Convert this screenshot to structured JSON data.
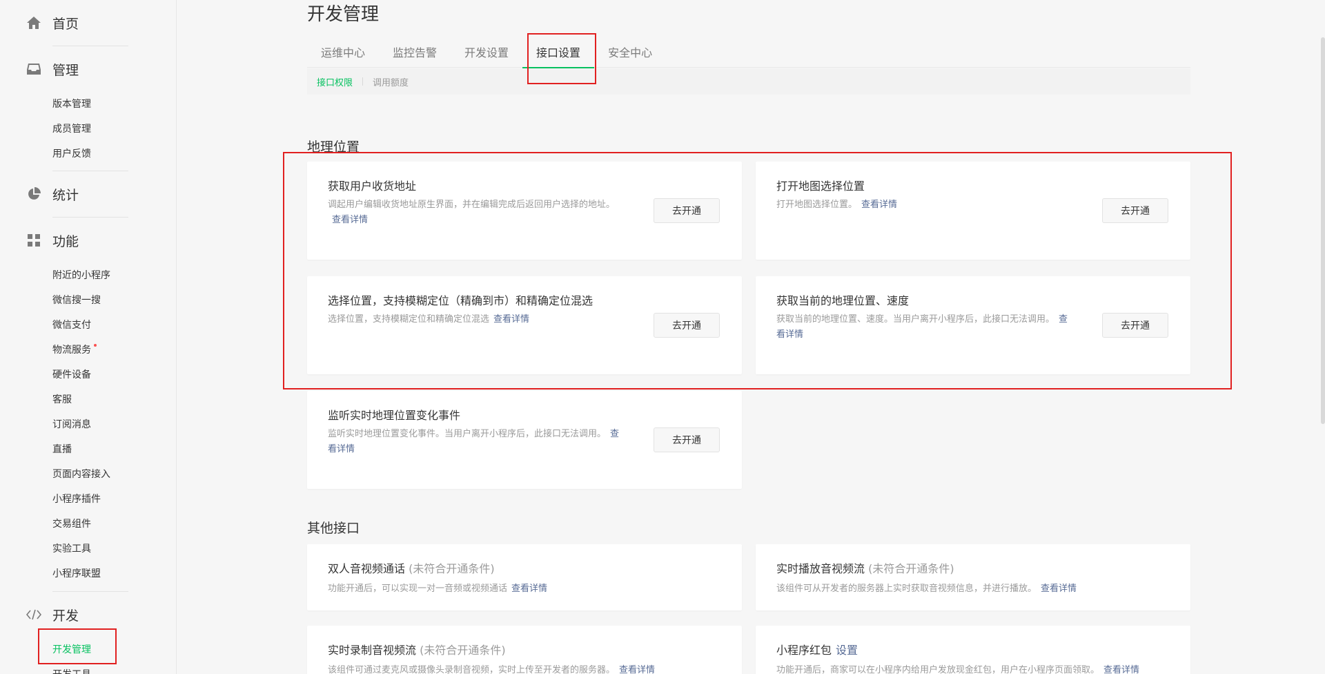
{
  "sidebar": {
    "home": {
      "label": "首页",
      "icon": "home-icon"
    },
    "manage": {
      "label": "管理",
      "icon": "inbox-icon",
      "items": [
        "版本管理",
        "成员管理",
        "用户反馈"
      ]
    },
    "stats": {
      "label": "统计",
      "icon": "pie-chart-icon"
    },
    "features": {
      "label": "功能",
      "icon": "grid-icon",
      "items": [
        "附近的小程序",
        "微信搜一搜",
        "微信支付",
        "物流服务",
        "硬件设备",
        "客服",
        "订阅消息",
        "直播",
        "页面内容接入",
        "小程序插件",
        "交易组件",
        "实验工具",
        "小程序联盟"
      ]
    },
    "dev": {
      "label": "开发",
      "icon": "code-icon",
      "items": [
        "开发管理",
        "开发工具"
      ]
    }
  },
  "main": {
    "title": "开发管理",
    "tabs": [
      "运维中心",
      "监控告警",
      "开发设置",
      "接口设置",
      "安全中心"
    ],
    "active_tab": "接口设置",
    "subtabs": [
      "接口权限",
      "调用额度"
    ],
    "active_subtab": "接口权限",
    "geo_section": {
      "title": "地理位置",
      "cards": [
        {
          "title": "获取用户收货地址",
          "desc": "调起用户编辑收货地址原生界面，并在编辑完成后返回用户选择的地址。",
          "link": "查看详情",
          "button": "去开通"
        },
        {
          "title": "打开地图选择位置",
          "desc": "打开地图选择位置。",
          "link": "查看详情",
          "button": "去开通"
        },
        {
          "title": "选择位置，支持模糊定位（精确到市）和精确定位混选",
          "desc": "选择位置，支持模糊定位和精确定位混选",
          "link": "查看详情",
          "button": "去开通"
        },
        {
          "title": "获取当前的地理位置、速度",
          "desc": "获取当前的地理位置、速度。当用户离开小程序后，此接口无法调用。",
          "link": "查看详情",
          "button": "去开通"
        },
        {
          "title": "监听实时地理位置变化事件",
          "desc": "监听实时地理位置变化事件。当用户离开小程序后，此接口无法调用。",
          "link": "查看详情",
          "button": "去开通"
        }
      ]
    },
    "other_section": {
      "title": "其他接口",
      "cards": [
        {
          "title": "双人音视频通话",
          "muted": "(未符合开通条件)",
          "desc": "功能开通后，可以实现一对一音频或视频通话",
          "link": "查看详情"
        },
        {
          "title": "实时播放音视频流",
          "muted": "(未符合开通条件)",
          "desc": "该组件可从开发者的服务器上实时获取音视频信息，并进行播放。",
          "link": "查看详情"
        },
        {
          "title": "实时录制音视频流",
          "muted": "(未符合开通条件)",
          "desc": "该组件可通过麦克风或摄像头录制音视频，实时上传至开发者的服务器。",
          "link": "查看详情"
        },
        {
          "title": "小程序红包",
          "title_link": "设置",
          "desc": "功能开通后，商家可以在小程序内给用户发放现金红包，用户在小程序页面领取。",
          "link": "查看详情"
        }
      ]
    }
  }
}
